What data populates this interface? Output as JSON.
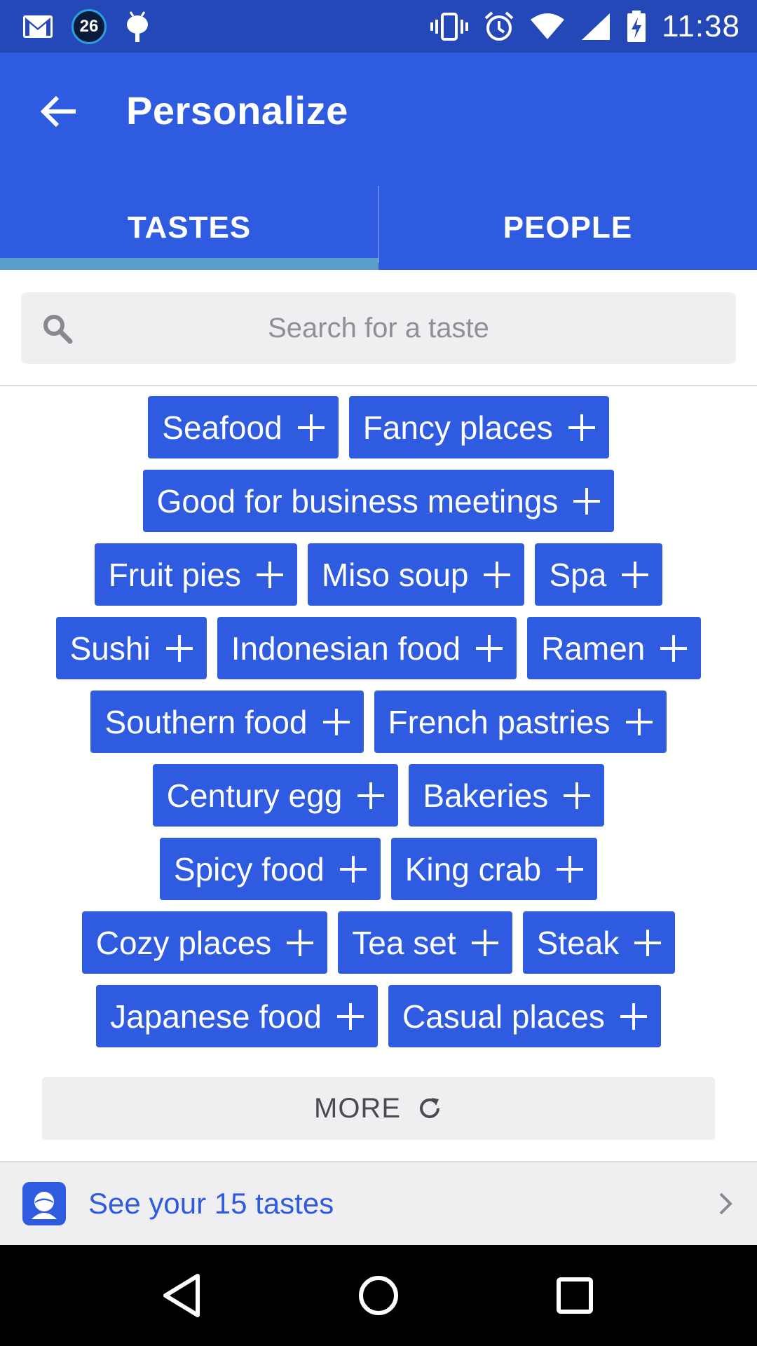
{
  "status_bar": {
    "notification_badge": "26",
    "time": "11:38"
  },
  "app_bar": {
    "title": "Personalize"
  },
  "tabs": [
    {
      "label": "TASTES",
      "active": true
    },
    {
      "label": "PEOPLE",
      "active": false
    }
  ],
  "search": {
    "placeholder": "Search for a taste",
    "value": ""
  },
  "tastes": {
    "rows": [
      [
        "Seafood",
        "Fancy places"
      ],
      [
        "Good for business meetings"
      ],
      [
        "Fruit pies",
        "Miso soup",
        "Spa"
      ],
      [
        "Sushi",
        "Indonesian food",
        "Ramen"
      ],
      [
        "Southern food",
        "French pastries"
      ],
      [
        "Century egg",
        "Bakeries"
      ],
      [
        "Spicy food",
        "King crab"
      ],
      [
        "Cozy places",
        "Tea set",
        "Steak"
      ],
      [
        "Japanese food",
        "Casual places"
      ]
    ]
  },
  "more": {
    "label": "MORE"
  },
  "footer": {
    "label": "See your 15 tastes"
  },
  "colors": {
    "primary": "#2f5be1",
    "status_bar": "#2448b8",
    "tab_indicator": "#5a9fc9"
  }
}
